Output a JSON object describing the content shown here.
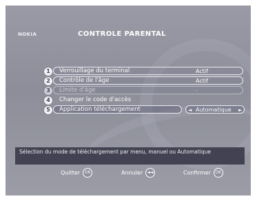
{
  "header": {
    "logo": "NOKIA",
    "title": "CONTROLE PARENTAL"
  },
  "menu": {
    "items": [
      {
        "number": "1",
        "label": "Verrouillage du terminal",
        "value": "Actif"
      },
      {
        "number": "2",
        "label": "Contrôle de l'âge",
        "value": "Actif"
      },
      {
        "number": "3",
        "label": "Limite d'âge",
        "value": "-"
      },
      {
        "number": "4",
        "label": "Changer le code d'accès",
        "value": ""
      },
      {
        "number": "5",
        "label": "Application téléchargement",
        "value": "Automatique",
        "prev_arrow": "◄",
        "next_arrow": "►"
      }
    ]
  },
  "help": {
    "text": "Sélection du mode de téléchargement par menu, manuel ou Automatique"
  },
  "footer": {
    "quit_label": "Quitter",
    "quit_key": "OK",
    "cancel_label": "Annuler",
    "cancel_key": "◄◄",
    "confirm_label": "Confirmer",
    "confirm_key": "OK"
  },
  "colors": {
    "background": "#9a9aa6",
    "help_bar": "#424252",
    "text": "#ffffff"
  }
}
